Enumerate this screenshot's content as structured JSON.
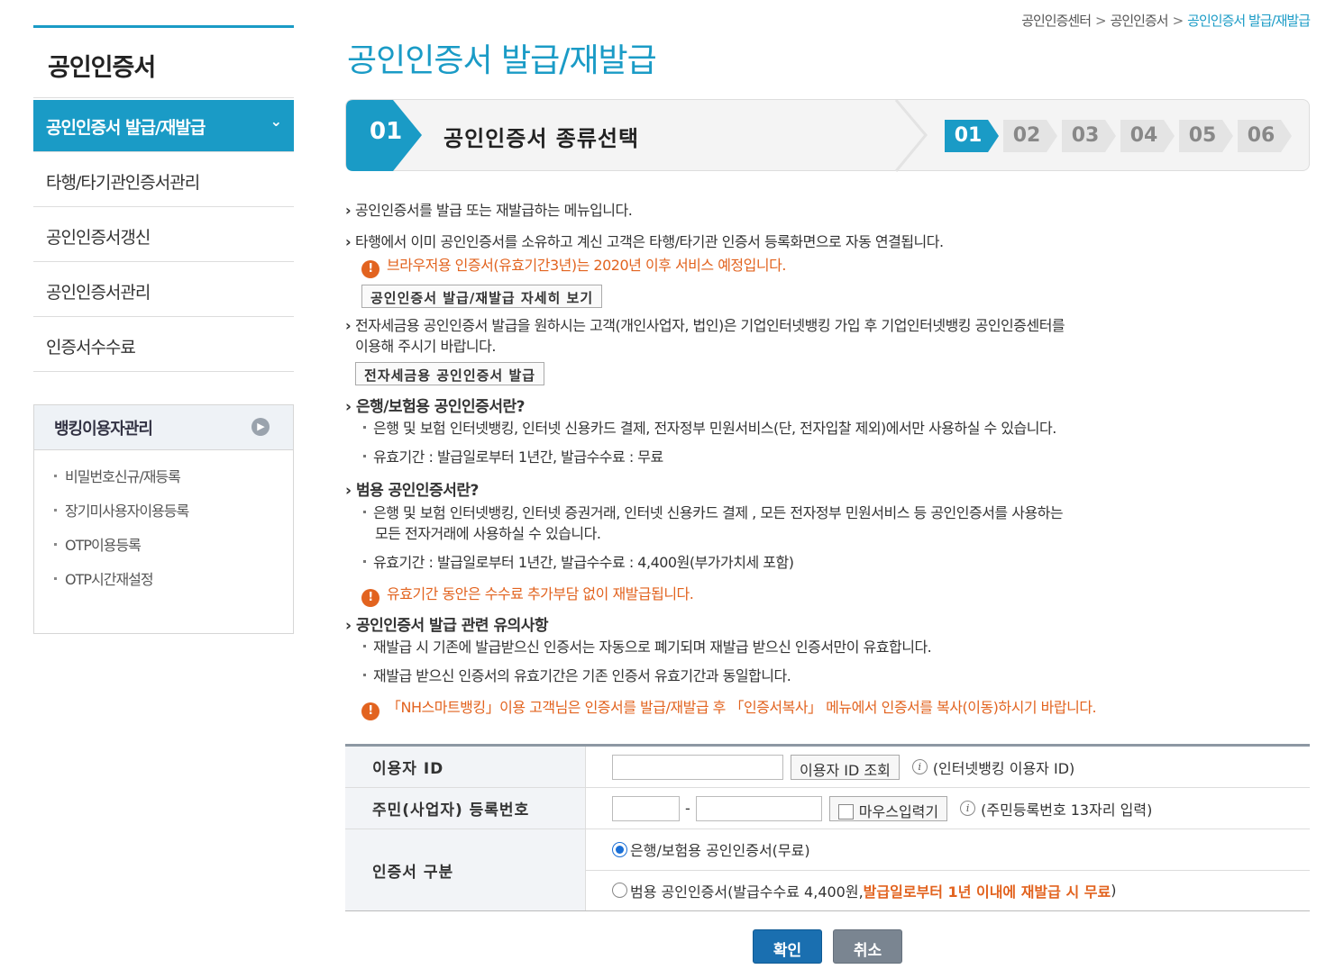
{
  "sidebar": {
    "title": "공인인증서",
    "items": [
      {
        "label": "공인인증서 발급/재발급"
      },
      {
        "label": "타행/타기관인증서관리"
      },
      {
        "label": "공인인증서갱신"
      },
      {
        "label": "공인인증서관리"
      },
      {
        "label": "인증서수수료"
      }
    ],
    "box": {
      "title": "뱅킹이용자관리",
      "items": [
        "비밀번호신규/재등록",
        "장기미사용자이용등록",
        "OTP이용등록",
        "OTP시간재설정"
      ]
    }
  },
  "breadcrumb": {
    "items": [
      "공인인증센터",
      "공인인증서"
    ],
    "current": "공인인증서 발급/재발급",
    "sep": ">"
  },
  "page_title": "공인인증서 발급/재발급",
  "steps": {
    "current_num": "01",
    "current_label": "공인인증서 종류선택",
    "chips": [
      "01",
      "02",
      "03",
      "04",
      "05",
      "06"
    ],
    "active_color": "#1a9bc6"
  },
  "content": {
    "p1": "공인인증서를 발급 또는 재발급하는 메뉴입니다.",
    "p2": "타행에서 이미 공인인증서를 소유하고 계신 고객은 타행/타기관 인증서 등록화면으로 자동 연결됩니다.",
    "warn1": "브라우저용 인증서(유효기간3년)는 2020년 이후 서비스 예정입니다.",
    "btn_detail": "공인인증서 발급/재발급 자세히 보기",
    "p3_line1": "전자세금용 공인인증서 발급을 원하시는 고객(개인사업자, 법인)은 기업인터넷뱅킹 가입 후 기업인터넷뱅킹 공인인증센터를",
    "p3_line2": "이용해 주시기 바랍니다.",
    "btn_tax": "전자세금용 공인인증서 발급",
    "h1": "은행/보험용 공인인증서란?",
    "h1_s1": "은행 및 보험 인터넷뱅킹, 인터넷 신용카드 결제, 전자정부 민원서비스(단, 전자입찰 제외)에서만 사용하실 수 있습니다.",
    "h1_s2": "유효기간 : 발급일로부터 1년간, 발급수수료 : 무료",
    "h2": "범용 공인인증서란?",
    "h2_s1_line1": "은행 및 보험 인터넷뱅킹, 인터넷 증권거래, 인터넷 신용카드 결제 , 모든 전자정부 민원서비스 등 공인인증서를 사용하는",
    "h2_s1_line2": "모든 전자거래에 사용하실 수 있습니다.",
    "h2_s2": "유효기간 : 발급일로부터 1년간, 발급수수료 : 4,400원(부가가치세 포함)",
    "warn2": "유효기간 동안은 수수료 추가부담 없이 재발급됩니다.",
    "h3": "공인인증서 발급 관련 유의사항",
    "h3_s1": "재발급 시 기존에 발급받으신 인증서는 자동으로 폐기되며 재발급 받으신 인증서만이 유효합니다.",
    "h3_s2": "재발급 받으신 인증서의 유효기간은 기존 인증서 유효기간과 동일합니다.",
    "warn3": "「NH스마트뱅킹」이용 고객님은 인증서를 발급/재발급 후 「인증서복사」 메뉴에서 인증서를 복사(이동)하시기 바랍니다."
  },
  "form": {
    "user_id": {
      "label": "이용자 ID",
      "button": "이용자 ID 조회",
      "hint": "(인터넷뱅킹 이용자 ID)",
      "value": ""
    },
    "rrn": {
      "label": "주민(사업자) 등록번호",
      "dash": "-",
      "mouse_input": "마우스입력기",
      "hint": "(주민등록번호 13자리 입력)"
    },
    "cert_type": {
      "label": "인증서 구분",
      "opt1": "은행/보험용 공인인증서(무료)",
      "opt2_prefix": "범용 공인인증서(발급수수료 4,400원, ",
      "opt2_highlight": "발급일로부터 1년 이내에 재발급 시 무료",
      "opt2_suffix": ")"
    }
  },
  "buttons": {
    "confirm": "확인",
    "cancel": "취소"
  },
  "colors": {
    "brand": "#1a9bc6",
    "warning": "#e2631f",
    "confirm": "#1a6fb0",
    "cancel": "#7a8591"
  }
}
